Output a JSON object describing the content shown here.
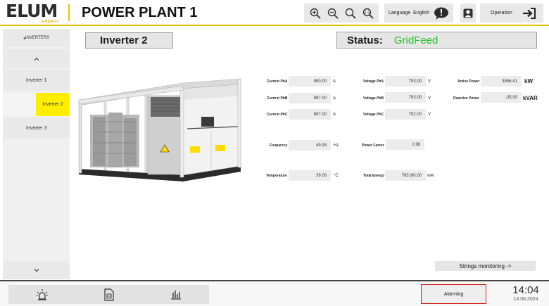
{
  "header": {
    "logo_text": "ELUM",
    "logo_sub": "ENERGY",
    "title": "POWER PLANT 1",
    "zoom_icons": [
      "zoom-in-icon",
      "zoom-out-icon",
      "zoom-reset-icon",
      "zoom-fit-icon"
    ],
    "language_label": "Language",
    "language_value": "English",
    "operation_label": "Operation"
  },
  "sidebar": {
    "section_label": "INVERTERS",
    "items": [
      {
        "label": "Inverter 1",
        "selected": false
      },
      {
        "label": "Inverter 2",
        "selected": true
      },
      {
        "label": "Inverter 3",
        "selected": false
      }
    ]
  },
  "main": {
    "inverter_title": "Inverter  2",
    "status_label": "Status:",
    "status_value": "GridFeed",
    "status_color": "#22c322",
    "column1": [
      {
        "label": "Current PhA",
        "value": "990.00",
        "unit": "A"
      },
      {
        "label": "Current PhB",
        "value": "987.00",
        "unit": "A"
      },
      {
        "label": "Current PhC",
        "value": "987.00",
        "unit": "A"
      },
      {
        "label": "Frequency",
        "value": "49.93",
        "unit": "Hz"
      },
      {
        "label": "Temperature",
        "value": "39.00",
        "unit": "°C"
      }
    ],
    "column2": [
      {
        "label": "Voltage PhA",
        "value": "793.00",
        "unit": "V"
      },
      {
        "label": "Voltage PhB",
        "value": "793.00",
        "unit": "V"
      },
      {
        "label": "Voltage PhC",
        "value": "792.00",
        "unit": "V"
      },
      {
        "label": "Power Factor",
        "value": "0.98",
        "unit": ""
      },
      {
        "label": "Total Energy",
        "value": "763160.00",
        "unit": "kWh"
      }
    ],
    "column3": [
      {
        "label": "Active Power",
        "value": "3856.41",
        "unit": "kW"
      },
      {
        "label": "Reactive Power",
        "value": "-35.00",
        "unit": "kVAR"
      }
    ],
    "strings_button": "Strings monitoring ->"
  },
  "footer": {
    "alarm_label": "Alarmlog",
    "alarm_border_color": "#d21f1f",
    "time": "14:04",
    "date": "14.06.2024"
  }
}
